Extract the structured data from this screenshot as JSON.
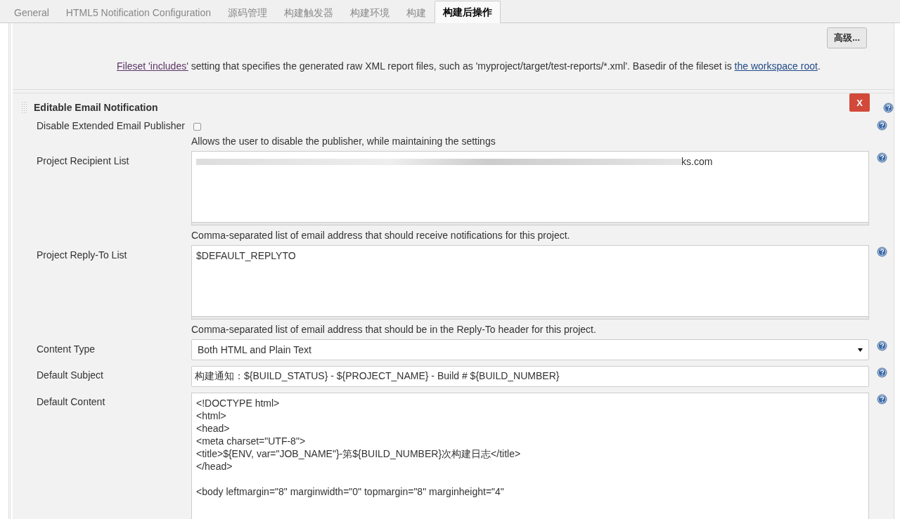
{
  "tabs": [
    {
      "label": "General",
      "selected": false
    },
    {
      "label": "HTML5 Notification Configuration",
      "selected": false
    },
    {
      "label": "源码管理",
      "selected": false
    },
    {
      "label": "构建触发器",
      "selected": false
    },
    {
      "label": "构建环境",
      "selected": false
    },
    {
      "label": "构建",
      "selected": false
    },
    {
      "label": "构建后操作",
      "selected": true
    }
  ],
  "junit_section": {
    "advanced_button": "高级...",
    "help_link": "Fileset 'includes'",
    "help_text": "setting that specifies the generated raw XML report files, such as 'myproject/target/test-reports/*.xml'. Basedir of the fileset is",
    "help_link_2": "the workspace root",
    "help_end": "."
  },
  "email_section": {
    "title": "Editable Email Notification",
    "delete_button": "X",
    "rows": [
      {
        "kind": "checkbox",
        "label": "Disable Extended Email Publisher",
        "checked": false,
        "description": "Allows the user to disable the publisher, while maintaining the settings"
      },
      {
        "kind": "textarea",
        "label": "Project Recipient List",
        "value": "ks.com",
        "redacted": true,
        "description": "Comma-separated list of email address that should receive notifications for this project."
      },
      {
        "kind": "textarea",
        "label": "Project Reply-To List",
        "value": "$DEFAULT_REPLYTO",
        "redacted": false,
        "description": "Comma-separated list of email address that should be in the Reply-To header for this project."
      },
      {
        "kind": "select",
        "label": "Content Type",
        "value": "Both HTML and Plain Text"
      },
      {
        "kind": "input",
        "label": "Default Subject",
        "value": "构建通知：${BUILD_STATUS} - ${PROJECT_NAME} - Build # ${BUILD_NUMBER}"
      },
      {
        "kind": "code",
        "label": "Default Content",
        "blocks": [
          [
            "<!DOCTYPE html>",
            "<html>",
            "<head>",
            "<meta charset=\"UTF-8\">",
            "<title>${ENV, var=\"JOB_NAME\"}-第${BUILD_NUMBER}次构建日志</title>",
            "</head>"
          ],
          [
            "<body leftmargin=\"8\" marginwidth=\"0\" topmargin=\"8\" marginheight=\"4\""
          ]
        ]
      }
    ]
  }
}
